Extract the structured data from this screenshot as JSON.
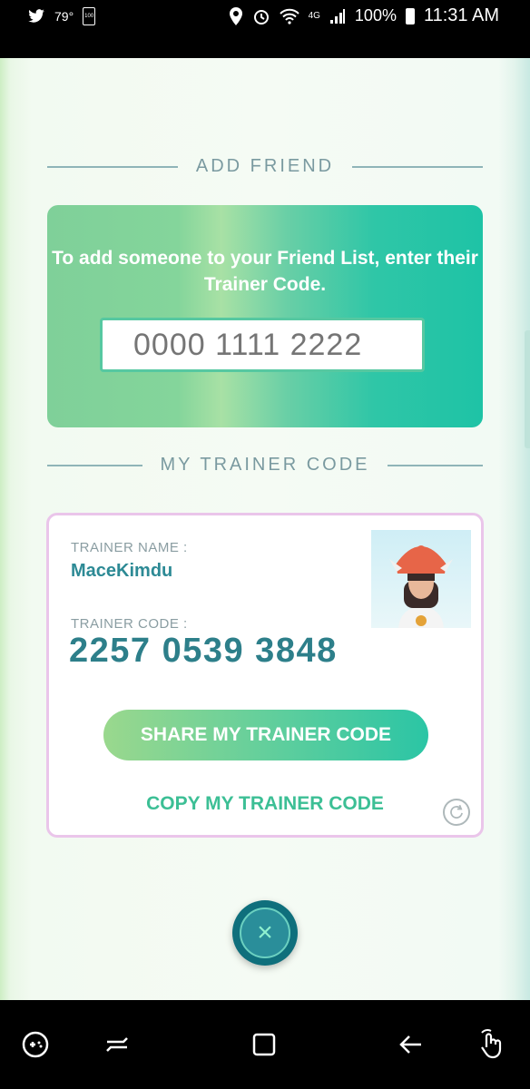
{
  "status_bar": {
    "temperature": "79°",
    "battery_small_label": "100",
    "network": "4G",
    "battery": "100%",
    "time": "11:31 AM"
  },
  "add_friend": {
    "section_title": "ADD FRIEND",
    "instruction": "To add someone to your Friend List, enter their Trainer Code.",
    "input_placeholder": "0000 1111 2222"
  },
  "my_trainer_code": {
    "section_title": "MY TRAINER CODE",
    "name_label": "TRAINER NAME :",
    "trainer_name": "MaceKimdu",
    "code_label": "TRAINER CODE :",
    "trainer_code": "2257 0539 3848",
    "share_button": "SHARE MY TRAINER CODE",
    "copy_link": "COPY MY TRAINER CODE"
  },
  "icons": {
    "close": "close-icon",
    "refresh": "refresh-icon"
  },
  "colors": {
    "teal_text": "#2d8a95",
    "accent_green": "#3cbf95",
    "card_border": "#eac5ea"
  }
}
